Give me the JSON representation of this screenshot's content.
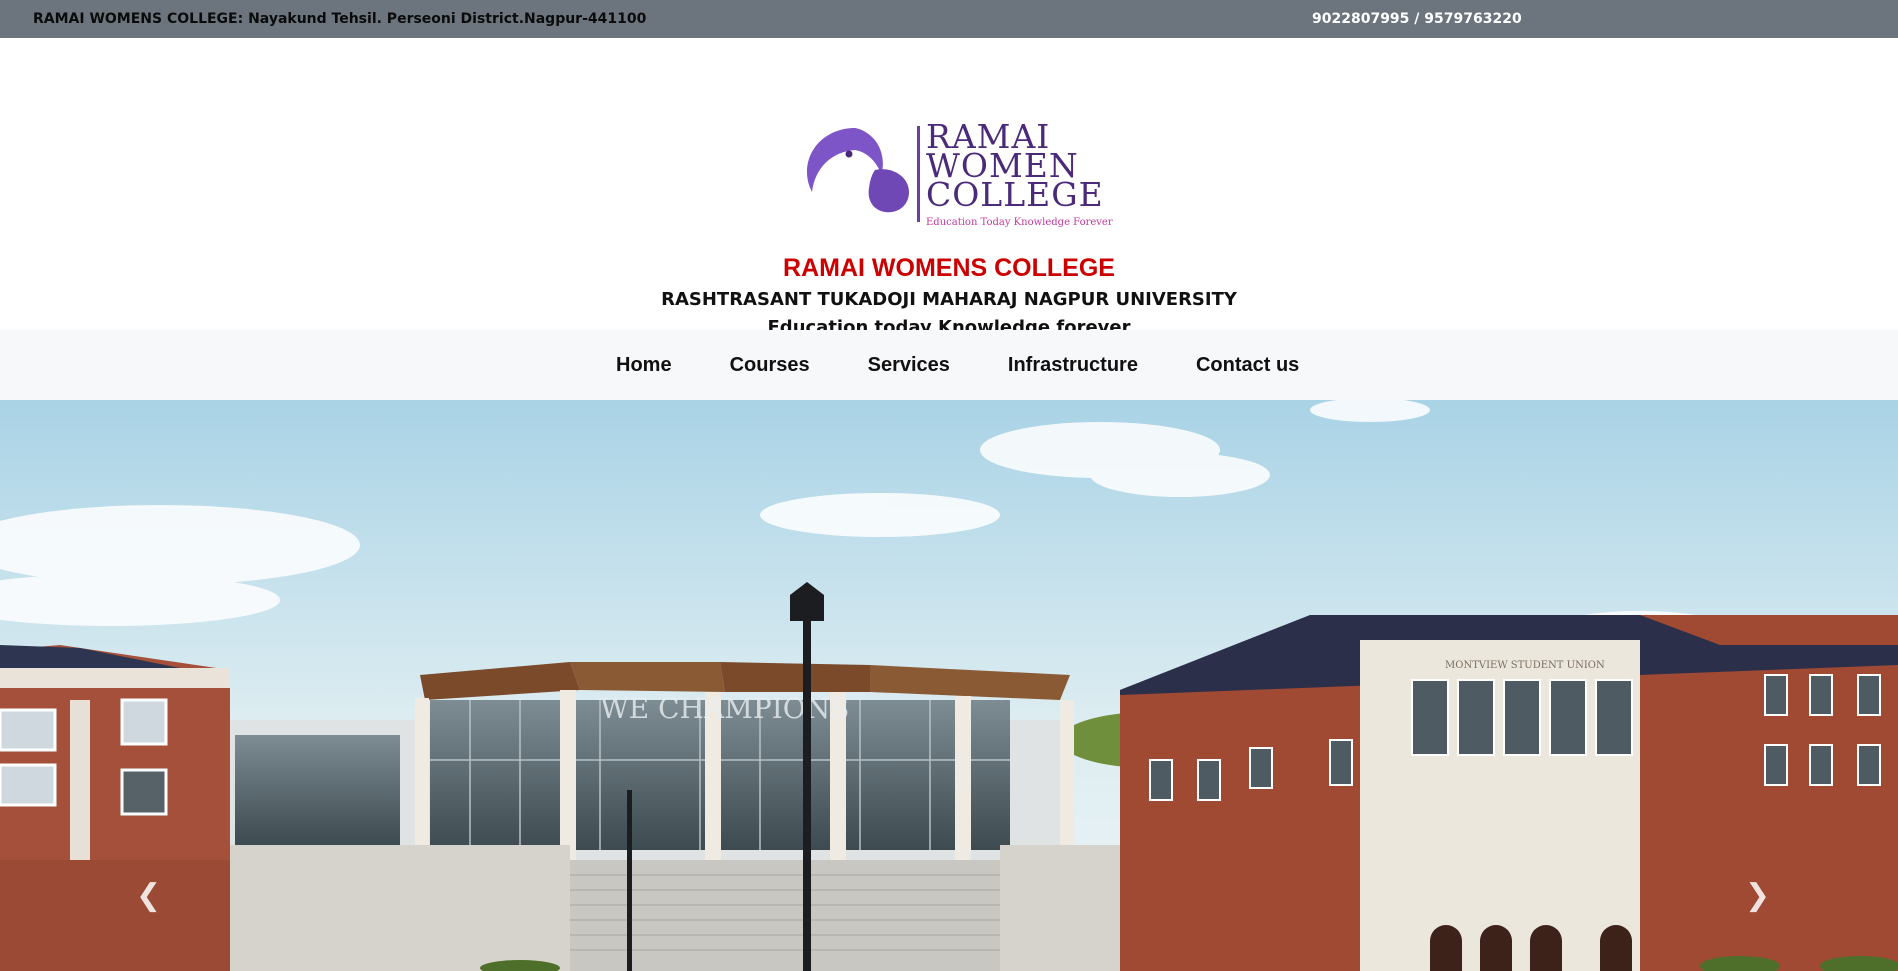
{
  "topbar": {
    "address": "RAMAI WOMENS COLLEGE: Nayakund Tehsil. Perseoni District.Nagpur-441100",
    "phones": "9022807995 / 9579763220"
  },
  "logo": {
    "word1": "RAMAI",
    "word2": "WOMEN",
    "word3": "COLLEGE",
    "tagline": "Education Today Knowledge Forever"
  },
  "header": {
    "college_name": "RAMAI WOMENS COLLEGE",
    "university": "RASHTRASANT TUKADOJI MAHARAJ NAGPUR UNIVERSITY",
    "motto": "Education today Knowledge forever"
  },
  "nav": {
    "items": [
      {
        "label": "Home"
      },
      {
        "label": "Courses"
      },
      {
        "label": "Services"
      },
      {
        "label": "Infrastructure"
      },
      {
        "label": "Contact us"
      }
    ]
  },
  "hero": {
    "sign_left": "WE  CHAMPIONS",
    "sign_right": "MONTVIEW STUDENT UNION",
    "prev_icon": "chevron-left-icon",
    "next_icon": "chevron-right-icon"
  },
  "colors": {
    "topbar_bg": "#6c757d",
    "title_red": "#cc0000",
    "logo_purple": "#6a3fa0",
    "nav_bg": "#f7f8fa"
  }
}
